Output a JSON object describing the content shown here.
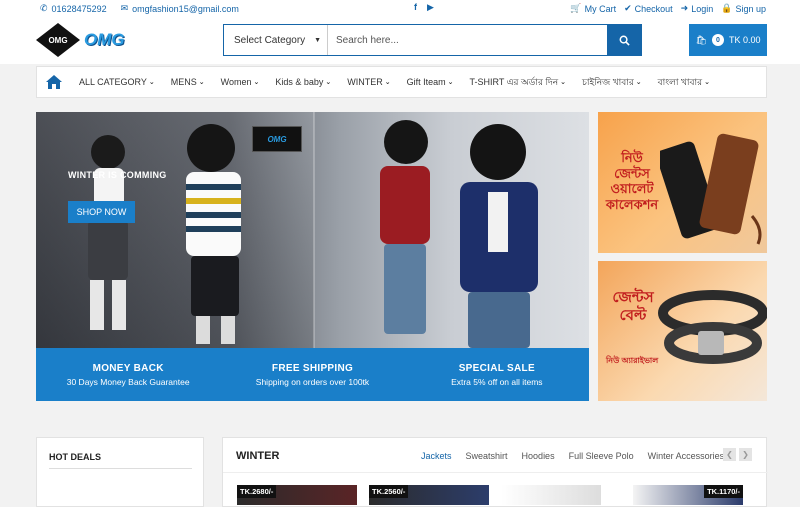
{
  "topbar": {
    "phone": "01628475292",
    "email": "omgfashion15@gmail.com",
    "social": [
      "facebook-icon",
      "youtube-icon"
    ],
    "links": [
      {
        "label": "My Cart",
        "icon": "cart-icon"
      },
      {
        "label": "Checkout",
        "icon": "check-icon"
      },
      {
        "label": "Login",
        "icon": "login-icon"
      },
      {
        "label": "Sign up",
        "icon": "lock-icon"
      }
    ]
  },
  "header": {
    "logo_text": "OMG",
    "logo_badge": "OMG",
    "category_label": "Select Category",
    "search_placeholder": "Search here...",
    "cart_count": "0",
    "cart_total": "TK 0.00"
  },
  "nav": {
    "items": [
      "ALL CATEGORY",
      "MENS",
      "Women",
      "Kids & baby",
      "WINTER",
      "Gift Iteam",
      "T-SHIRT এর অর্ডার দিন",
      "চাইনিজ খাবার",
      "বাংলা খাবার"
    ]
  },
  "hero": {
    "tagline": "WINTER IS COMMING",
    "shop_label": "SHOP NOW",
    "badge": "OMG"
  },
  "features": [
    {
      "title": "MONEY BACK",
      "subtitle": "30 Days Money Back Guarantee"
    },
    {
      "title": "FREE SHIPPING",
      "subtitle": "Shipping on orders over 100tk"
    },
    {
      "title": "SPECIAL SALE",
      "subtitle": "Extra 5% off on all items"
    }
  ],
  "promos": [
    {
      "text": "নিউ জেন্টস ওয়ালেট কালেকশন"
    },
    {
      "text": "জেন্টস বেল্ট",
      "sub": "নিউ অ্যারাইভাল"
    }
  ],
  "hot_deals": {
    "title": "HOT DEALS"
  },
  "winter": {
    "title": "WINTER",
    "tabs": [
      "Jackets",
      "Sweatshirt",
      "Hoodies",
      "Full Sleeve Polo",
      "Winter Accessories"
    ],
    "prices": [
      "TK.2680/-",
      "TK.2560/-",
      "TK.1170/-"
    ]
  },
  "colors": {
    "primary": "#1565a8",
    "accent": "#1a7fc9",
    "promo_text": "#c21f1f"
  }
}
